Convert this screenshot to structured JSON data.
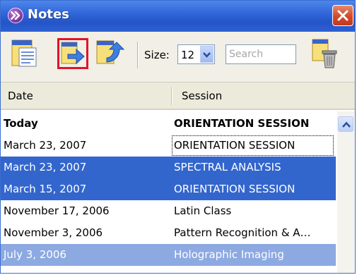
{
  "window": {
    "title": "Notes"
  },
  "toolbar": {
    "size_label": "Size:",
    "size_value": "12",
    "search_placeholder": "Search"
  },
  "table": {
    "columns": [
      "Date",
      "Session"
    ],
    "rows": [
      {
        "date": "Today",
        "session": "ORIENTATION SESSION",
        "state": "bold"
      },
      {
        "date": "March 23, 2007",
        "session": "ORIENTATION SESSION",
        "state": "focused"
      },
      {
        "date": "March 23, 2007",
        "session": "SPECTRAL ANALYSIS",
        "state": "selected"
      },
      {
        "date": "March 15, 2007",
        "session": "ORIENTATION SESSION",
        "state": "selected"
      },
      {
        "date": "November 17, 2006",
        "session": "Latin Class",
        "state": "normal"
      },
      {
        "date": "November 3, 2006",
        "session": "Pattern Recognition & A…",
        "state": "normal"
      },
      {
        "date": "July 3, 2006",
        "session": "Holographic Imaging",
        "state": "selected-light"
      }
    ]
  },
  "colors": {
    "titlebar": "#2f63d7",
    "selection": "#3366cc",
    "selection_light": "#8ca9e1",
    "highlight_border": "#e0142a"
  },
  "icons": {
    "title": "notes-logo-icon",
    "close": "close-icon",
    "toolbar": [
      "new-note-icon",
      "export-note-icon",
      "import-note-icon",
      "delete-note-icon"
    ],
    "size_dropdown": "chevron-down-icon",
    "scroll_up": "chevron-up-icon"
  }
}
